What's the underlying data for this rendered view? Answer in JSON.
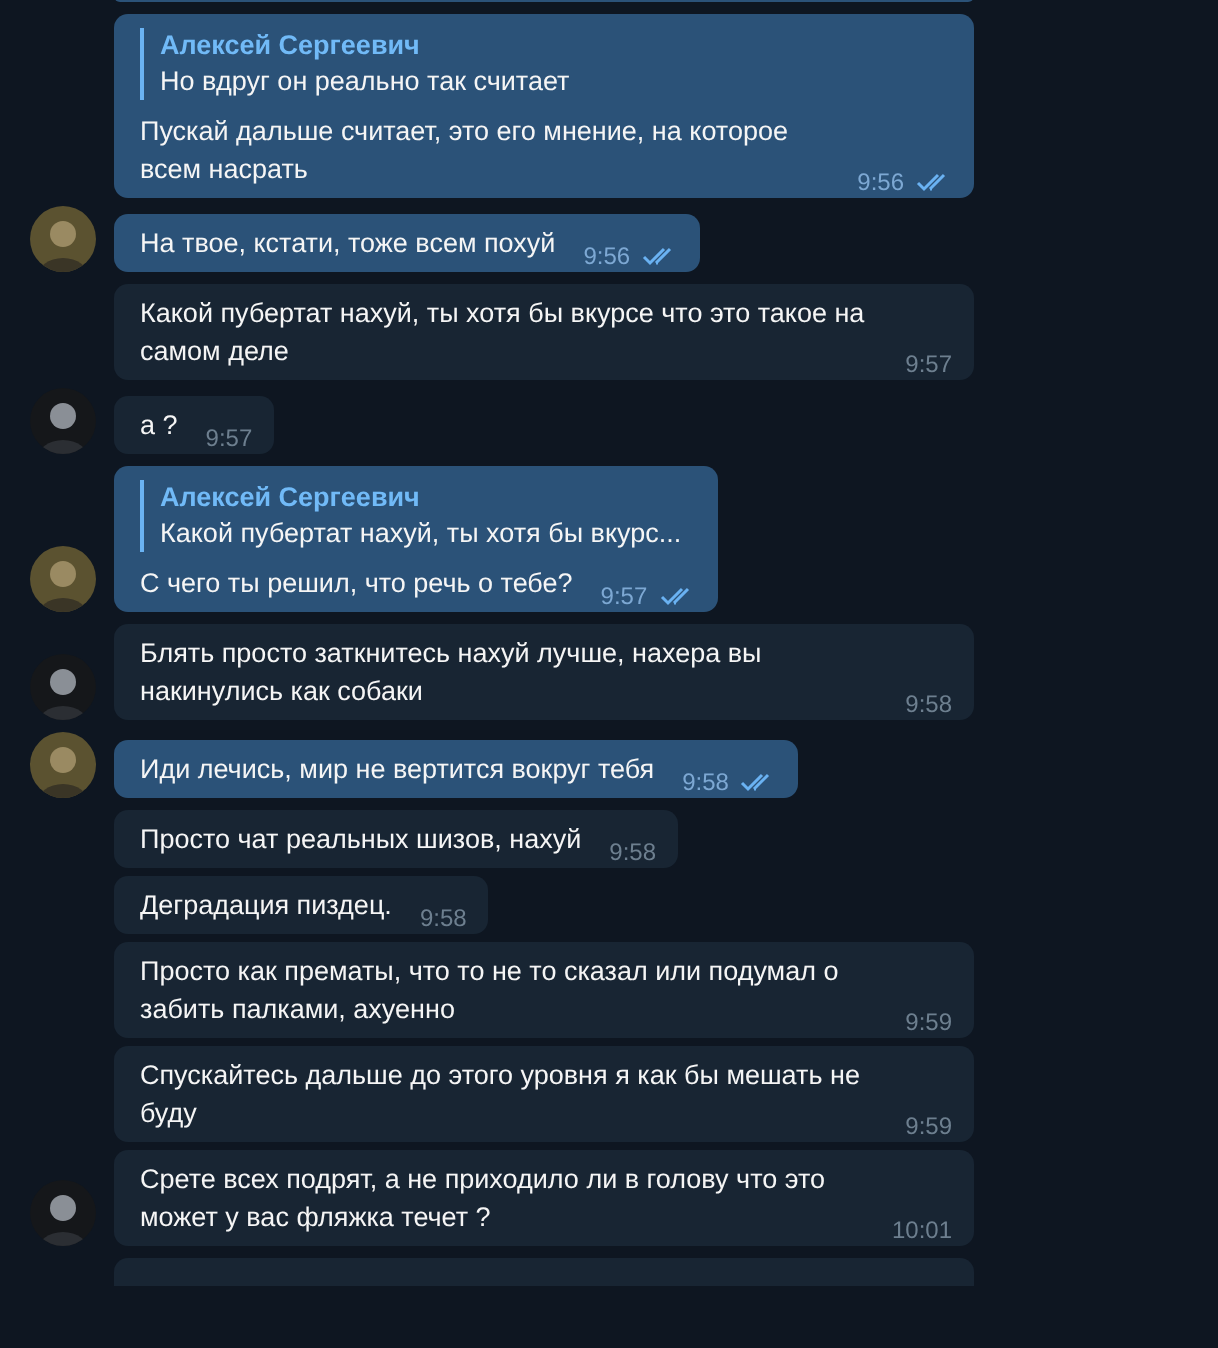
{
  "messages": [
    {
      "kind": "clipped",
      "outgoing": true
    },
    {
      "kind": "text",
      "outgoing": true,
      "avatar": false,
      "reply": {
        "author": "Алексей Сергеевич",
        "text": "Но вдруг он реально так считает"
      },
      "text": "Пускай дальше считает, это его мнение, на которое всем насрать",
      "time": "9:56",
      "read": true
    },
    {
      "kind": "text",
      "outgoing": true,
      "avatar": true,
      "text": "На твое, кстати, тоже всем похуй",
      "time": "9:56",
      "read": true
    },
    {
      "kind": "text",
      "outgoing": false,
      "avatar": false,
      "text": "Какой пубертат нахуй, ты хотя бы вкурсе что это такое на самом деле",
      "time": "9:57"
    },
    {
      "kind": "text",
      "outgoing": false,
      "avatar": true,
      "text": "а ?",
      "time": "9:57"
    },
    {
      "kind": "text",
      "outgoing": true,
      "avatar": true,
      "reply": {
        "author": "Алексей Сергеевич",
        "text": "Какой пубертат нахуй, ты хотя бы вкурс..."
      },
      "text": "С чего ты решил, что речь о тебе?",
      "time": "9:57",
      "read": true
    },
    {
      "kind": "text",
      "outgoing": false,
      "avatar": true,
      "text": "Блять просто заткнитесь нахуй лучше, нахера вы накинулись как собаки",
      "time": "9:58"
    },
    {
      "kind": "text",
      "outgoing": true,
      "avatar": true,
      "text": "Иди лечись, мир не вертится вокруг тебя",
      "time": "9:58",
      "read": true
    },
    {
      "kind": "text",
      "outgoing": false,
      "avatar": false,
      "text": "Просто чат реальных шизов, нахуй",
      "time": "9:58"
    },
    {
      "kind": "text",
      "outgoing": false,
      "avatar": false,
      "text": "Деградация пиздец.",
      "time": "9:58"
    },
    {
      "kind": "text",
      "outgoing": false,
      "avatar": false,
      "text": "Просто как прематы, что то не то сказал или подумал о забить палками, ахуенно",
      "time": "9:59"
    },
    {
      "kind": "text",
      "outgoing": false,
      "avatar": false,
      "text": "Спускайтесь дальше до этого уровня я как бы мешать не буду",
      "time": "9:59"
    },
    {
      "kind": "text",
      "outgoing": false,
      "avatar": true,
      "text": "Срете всех подрят, а не приходило ли в голову что это может у вас фляжка течет ?",
      "time": "10:01"
    },
    {
      "kind": "clipped",
      "outgoing": false
    }
  ]
}
